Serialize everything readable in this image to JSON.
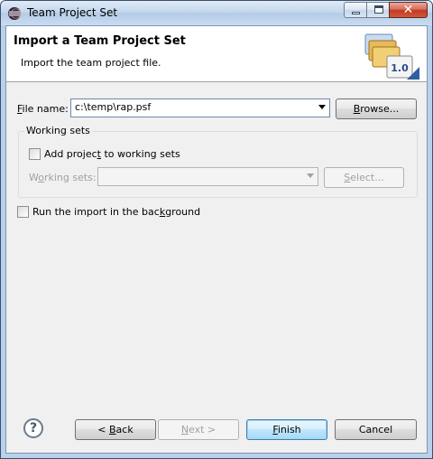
{
  "window": {
    "title": "Team Project Set"
  },
  "banner": {
    "title": "Import a Team Project Set",
    "description": "Import the team project file.",
    "image_badge": "1.0"
  },
  "file": {
    "label_prefix": "",
    "label_underlined": "F",
    "label_rest": "ile name:",
    "value": "c:\\temp\\rap.psf",
    "browse_prefix": "",
    "browse_underlined": "B",
    "browse_rest": "rowse..."
  },
  "working_sets": {
    "group_title": "Working sets",
    "add_checkbox_prefix": "Add projec",
    "add_checkbox_underlined": "t",
    "add_checkbox_rest": " to working sets",
    "add_checked": false,
    "label_prefix": "W",
    "label_underlined": "o",
    "label_rest": "rking sets:",
    "selected_value": "",
    "select_prefix": "",
    "select_underlined": "S",
    "select_rest": "elect..."
  },
  "background": {
    "label_prefix": "Run the import in the bac",
    "label_underlined": "k",
    "label_rest": "ground",
    "checked": false
  },
  "footer": {
    "help_glyph": "?",
    "back_prefix": "< ",
    "back_underlined": "B",
    "back_rest": "ack",
    "next_prefix": "",
    "next_underlined": "N",
    "next_rest": "ext >",
    "finish_prefix": "",
    "finish_underlined": "F",
    "finish_rest": "inish",
    "cancel_label": "Cancel"
  },
  "icons": {
    "app": "eclipse-icon",
    "minimize": "minimize-icon",
    "maximize": "maximize-icon",
    "close": "close-icon",
    "help": "help-icon",
    "banner": "team-project-set-icon"
  }
}
